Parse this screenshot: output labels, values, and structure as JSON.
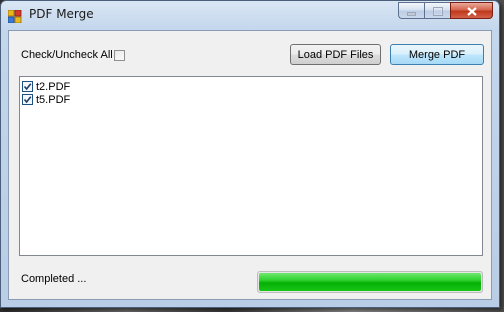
{
  "window": {
    "title": "PDF Merge"
  },
  "toolbar": {
    "check_all_label": "Check/Uncheck All",
    "check_all_checked": false,
    "load_button": "Load PDF Files",
    "merge_button": "Merge PDF"
  },
  "file_list": {
    "items": [
      {
        "name": "t2.PDF",
        "checked": true
      },
      {
        "name": "t5.PDF",
        "checked": true
      }
    ]
  },
  "status": {
    "text": "Completed ...",
    "progress": 1.0
  },
  "colors": {
    "progress_fill": "#06b006",
    "window_frame": "#c3d6ec"
  }
}
